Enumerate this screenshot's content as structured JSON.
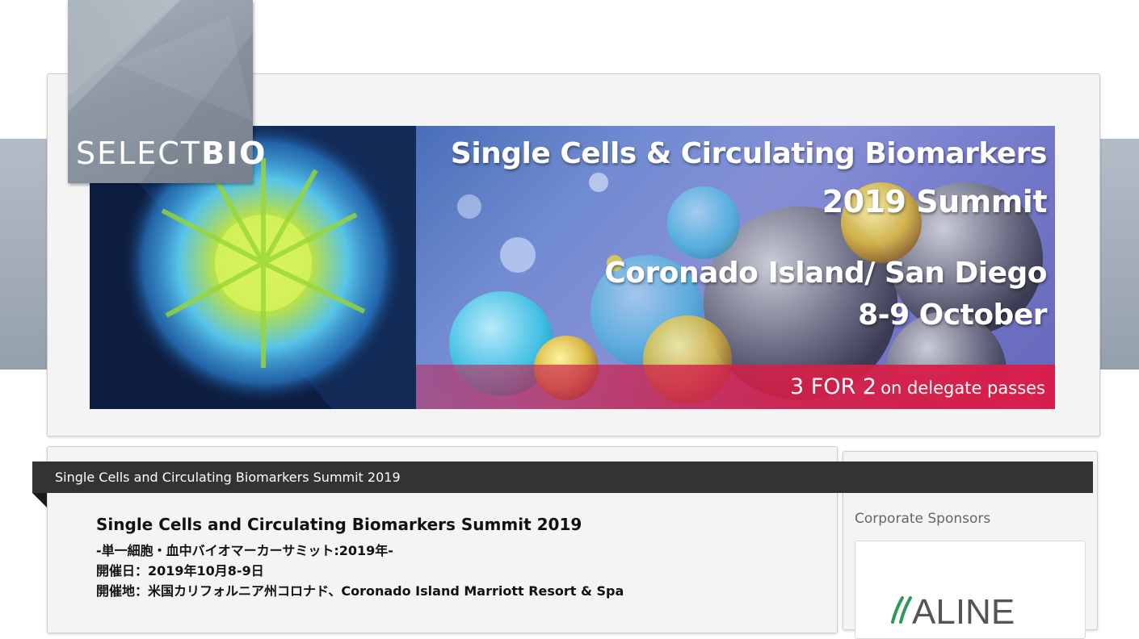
{
  "header": {
    "logo": {
      "text_light": "SELECT",
      "text_bold": "BIO"
    },
    "banner": {
      "line1": "Single Cells & Circulating Biomarkers",
      "line2": "2019 Summit",
      "line3": "Coronado Island/ San Diego",
      "line4": "8-9 October",
      "offer_big": "3 FOR 2",
      "offer_small": "on delegate passes"
    }
  },
  "main": {
    "title_bar": "Single Cells and Circulating Biomarkers Summit 2019",
    "event_title": "Single Cells and Circulating Biomarkers Summit 2019",
    "subtitle": "-単一細胞・血中バイオマーカーサミット:2019年-",
    "date_line": "開催日：2019年10月8-9日",
    "venue_line": "開催地：米国カリフォルニア州コロナド、Coronado Island Marriott Resort & Spa"
  },
  "sidebar": {
    "heading": "Corporate Sponsors",
    "sponsor_name": "ALINE"
  },
  "colors": {
    "title_bar_bg": "#333333",
    "offer_bar": "#d81f4c",
    "sponsor_green": "#2e9a5a",
    "sponsor_gray": "#555555"
  }
}
